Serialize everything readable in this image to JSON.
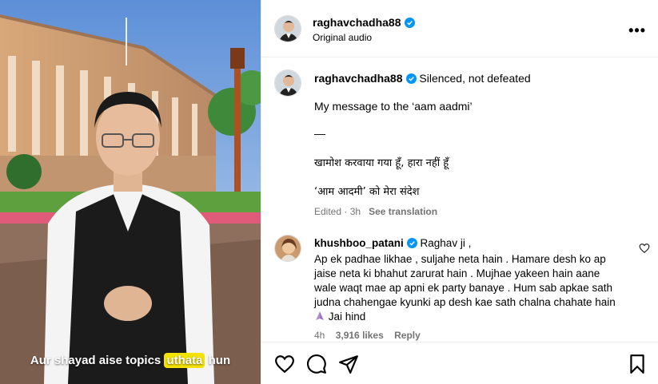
{
  "video": {
    "caption_before": "Aur shayad aise topics ",
    "caption_highlight": "uthata",
    "caption_after": " hun"
  },
  "header": {
    "username": "raghavchadha88",
    "audio_label": "Original audio",
    "more_icon": "more-horizontal-icon"
  },
  "post": {
    "username": "raghavchadha88",
    "title": "Silenced, not defeated",
    "line1": "My message to the ‘aam aadmi’",
    "line2": "—",
    "line3": "खामोश करवाया गया हूँ, हारा नहीं हूँ",
    "line4": "‘आम आदमी’ को मेरा संदेश",
    "edited": "Edited · 3h",
    "see_translation": "See translation"
  },
  "comment": {
    "username": "khushboo_patani",
    "line1": "Raghav ji ,",
    "line2": "Ap ek padhae likhae , suljahe neta hain . Hamare desh ko ap",
    "line3": "jaise neta ki bhahut zarurat hain . Mujhae yakeen hain aane",
    "line4": "wale waqt mae ap apni ek party banaye . Hum sab apkae sath",
    "line5": "judna chahengae kyunki ap desh kae sath chalna chahate hain",
    "line6": "Jai hind",
    "time": "4h",
    "likes": "3,916 likes",
    "reply": "Reply"
  },
  "colors": {
    "verified": "#0095f6",
    "caption_highlight": "#f4e200",
    "meta_gray": "#737373"
  }
}
